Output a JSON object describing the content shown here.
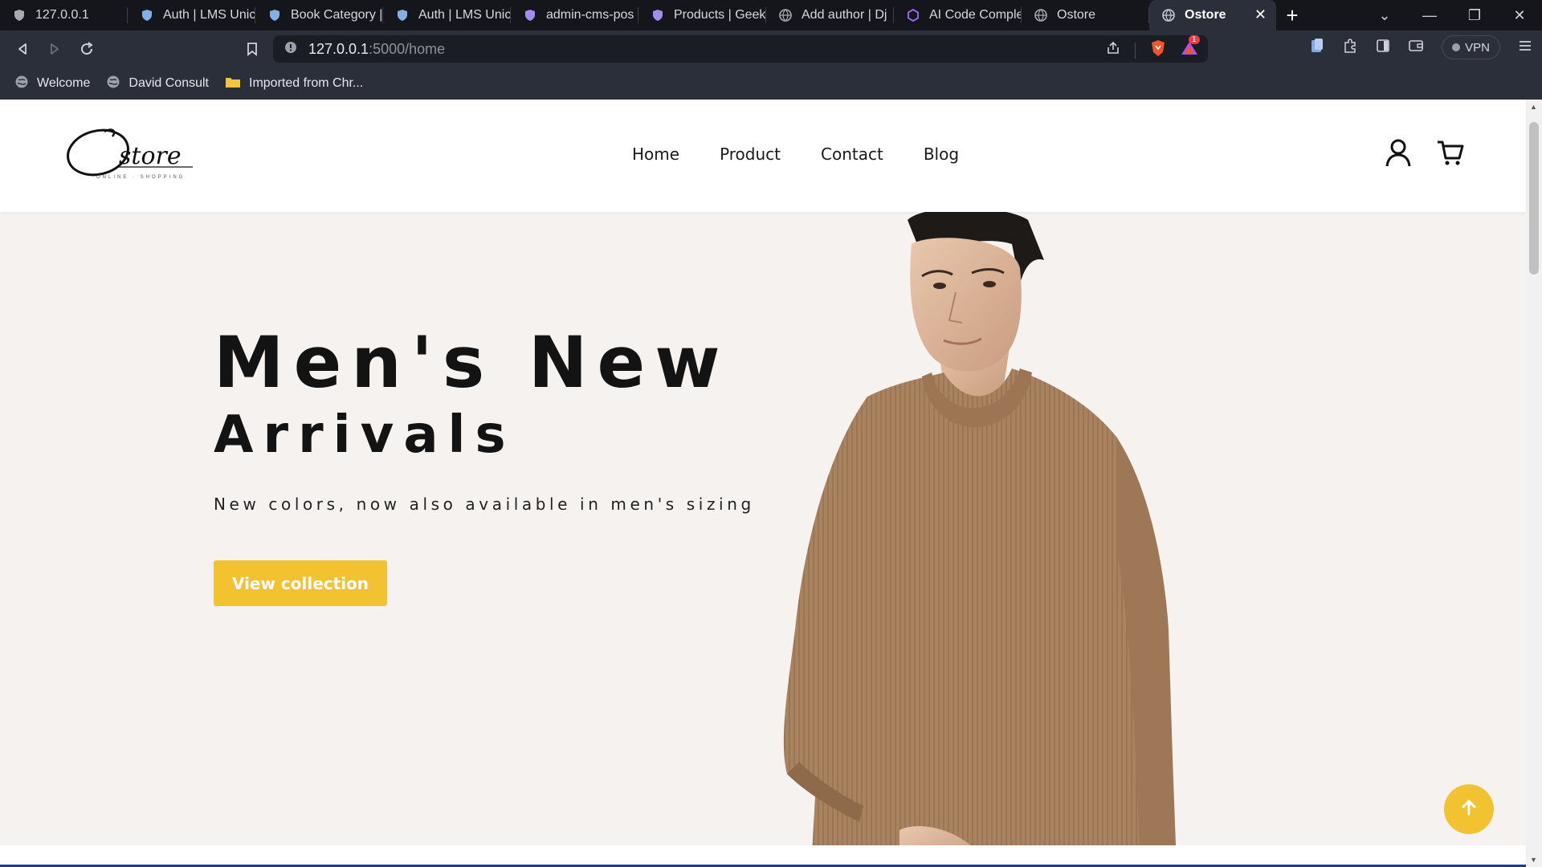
{
  "browser": {
    "tabs": [
      {
        "title": "127.0.0.1",
        "icon": "shield-icon"
      },
      {
        "title": "Auth | LMS Unic",
        "icon": "shield-icon"
      },
      {
        "title": "Book Category |",
        "icon": "shield-icon"
      },
      {
        "title": "Auth | LMS Unic",
        "icon": "shield-icon"
      },
      {
        "title": "admin-cms-pos",
        "icon": "shield-icon"
      },
      {
        "title": "Products | Geek",
        "icon": "shield-icon"
      },
      {
        "title": "Add author | Dj",
        "icon": "globe-icon"
      },
      {
        "title": "AI Code Comple",
        "icon": "hexagon-icon"
      },
      {
        "title": "Ostore",
        "icon": "globe-icon"
      }
    ],
    "active_tab": {
      "title": "Ostore",
      "close": "✕"
    },
    "new_tab": "+",
    "url_host": "127.0.0.1",
    "url_path": ":5000/home",
    "vpn_label": "VPN",
    "brave_badge": "1",
    "bookmarks": [
      {
        "label": "Welcome",
        "icon": "globe-icon"
      },
      {
        "label": "David Consult",
        "icon": "globe-icon"
      },
      {
        "label": "Imported from Chr...",
        "icon": "folder-icon"
      }
    ]
  },
  "site": {
    "logo_text": "store",
    "logo_initial": "O",
    "logo_tagline": "ONLINE · SHOPPING",
    "nav": [
      "Home",
      "Product",
      "Contact",
      "Blog"
    ],
    "hero": {
      "title_line1": "Men's New",
      "title_line2": "Arrivals",
      "subtitle": "New colors, now also available in men's sizing",
      "cta": "View collection"
    }
  },
  "colors": {
    "accent": "#f2c230",
    "hero_bg": "#f6f2ef",
    "sweater": "#a9825f",
    "chrome_bg": "#2b2f3a"
  }
}
